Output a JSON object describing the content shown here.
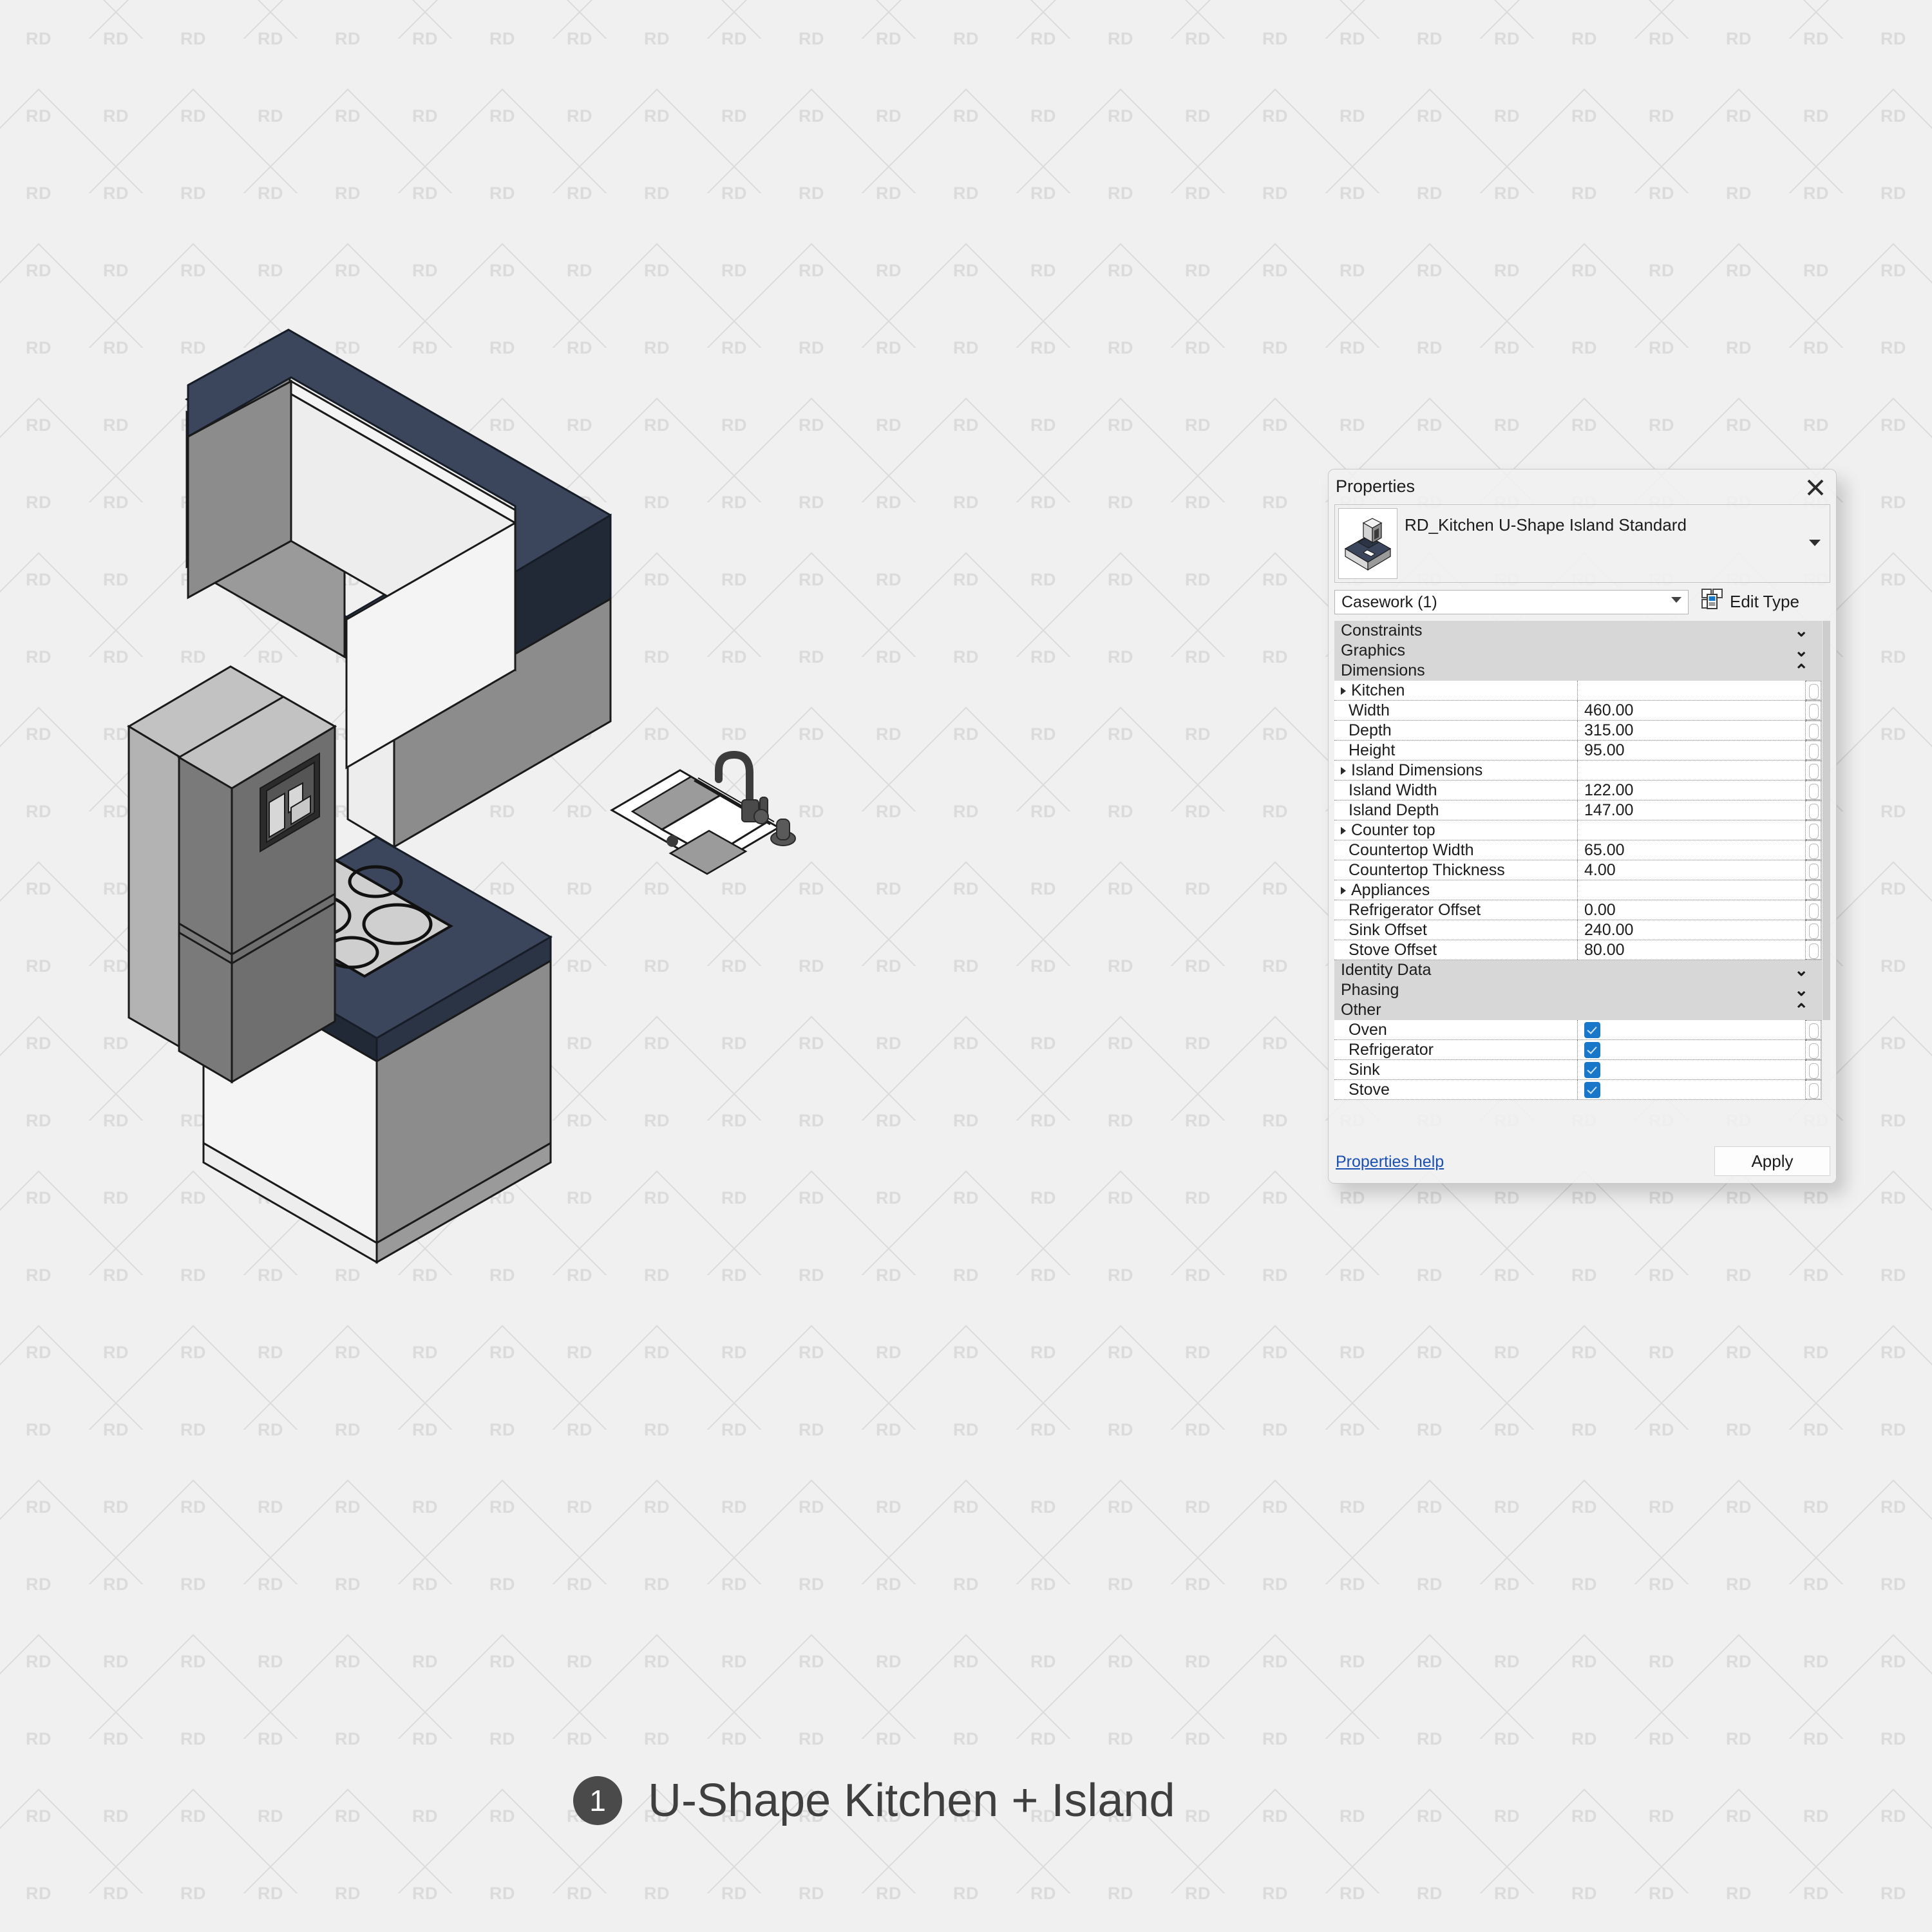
{
  "caption": {
    "number": "1",
    "text": "U-Shape Kitchen + Island"
  },
  "watermark": {
    "text": "RD"
  },
  "colors": {
    "countertop_top": "#3b465c",
    "countertop_edge": "#232a38",
    "cabinet_front": "#8c8c8c",
    "cabinet_side": "#f2f2f2",
    "fridge_body": "#b0b0b0",
    "fridge_door": "#707070",
    "accent_blue": "#1877c9",
    "link_blue": "#1a4fb4",
    "background": "#f0f0f0"
  },
  "properties_panel": {
    "title": "Properties",
    "close_label": "×",
    "type_name": "RD_Kitchen U-Shape Island Standard",
    "category": "Casework (1)",
    "edit_type_label": "Edit Type",
    "help_label": "Properties help",
    "apply_label": "Apply",
    "groups": [
      {
        "label": "Constraints",
        "state": "collapsed"
      },
      {
        "label": "Graphics",
        "state": "collapsed"
      },
      {
        "label": "Dimensions",
        "state": "expanded"
      }
    ],
    "dimension_rows": [
      {
        "key": "Kitchen",
        "value": "",
        "header": true
      },
      {
        "key": "Width",
        "value": "460.00",
        "header": false
      },
      {
        "key": "Depth",
        "value": "315.00",
        "header": false
      },
      {
        "key": "Height",
        "value": "95.00",
        "header": false
      },
      {
        "key": "Island Dimensions",
        "value": "",
        "header": true
      },
      {
        "key": "Island Width",
        "value": "122.00",
        "header": false
      },
      {
        "key": "Island Depth",
        "value": "147.00",
        "header": false
      },
      {
        "key": "Counter top",
        "value": "",
        "header": true
      },
      {
        "key": "Countertop Width",
        "value": "65.00",
        "header": false
      },
      {
        "key": "Countertop Thickness",
        "value": "4.00",
        "header": false
      },
      {
        "key": "Appliances",
        "value": "",
        "header": true
      },
      {
        "key": "Refrigerator Offset",
        "value": "0.00",
        "header": false
      },
      {
        "key": "Sink Offset",
        "value": "240.00",
        "header": false
      },
      {
        "key": "Stove Offset",
        "value": "80.00",
        "header": false
      }
    ],
    "lower_groups": [
      {
        "label": "Identity Data",
        "state": "collapsed"
      },
      {
        "label": "Phasing",
        "state": "collapsed"
      },
      {
        "label": "Other",
        "state": "expanded"
      }
    ],
    "other_rows": [
      {
        "key": "Oven",
        "checked": true
      },
      {
        "key": "Refrigerator",
        "checked": true
      },
      {
        "key": "Sink",
        "checked": true
      },
      {
        "key": "Stove",
        "checked": true
      }
    ]
  },
  "scene": {
    "description": "Isometric U-shape kitchen with island, refrigerator, sink and cooktop",
    "objects": [
      "refrigerator",
      "u-shape-counter",
      "island",
      "sink",
      "faucet",
      "cooktop"
    ]
  }
}
